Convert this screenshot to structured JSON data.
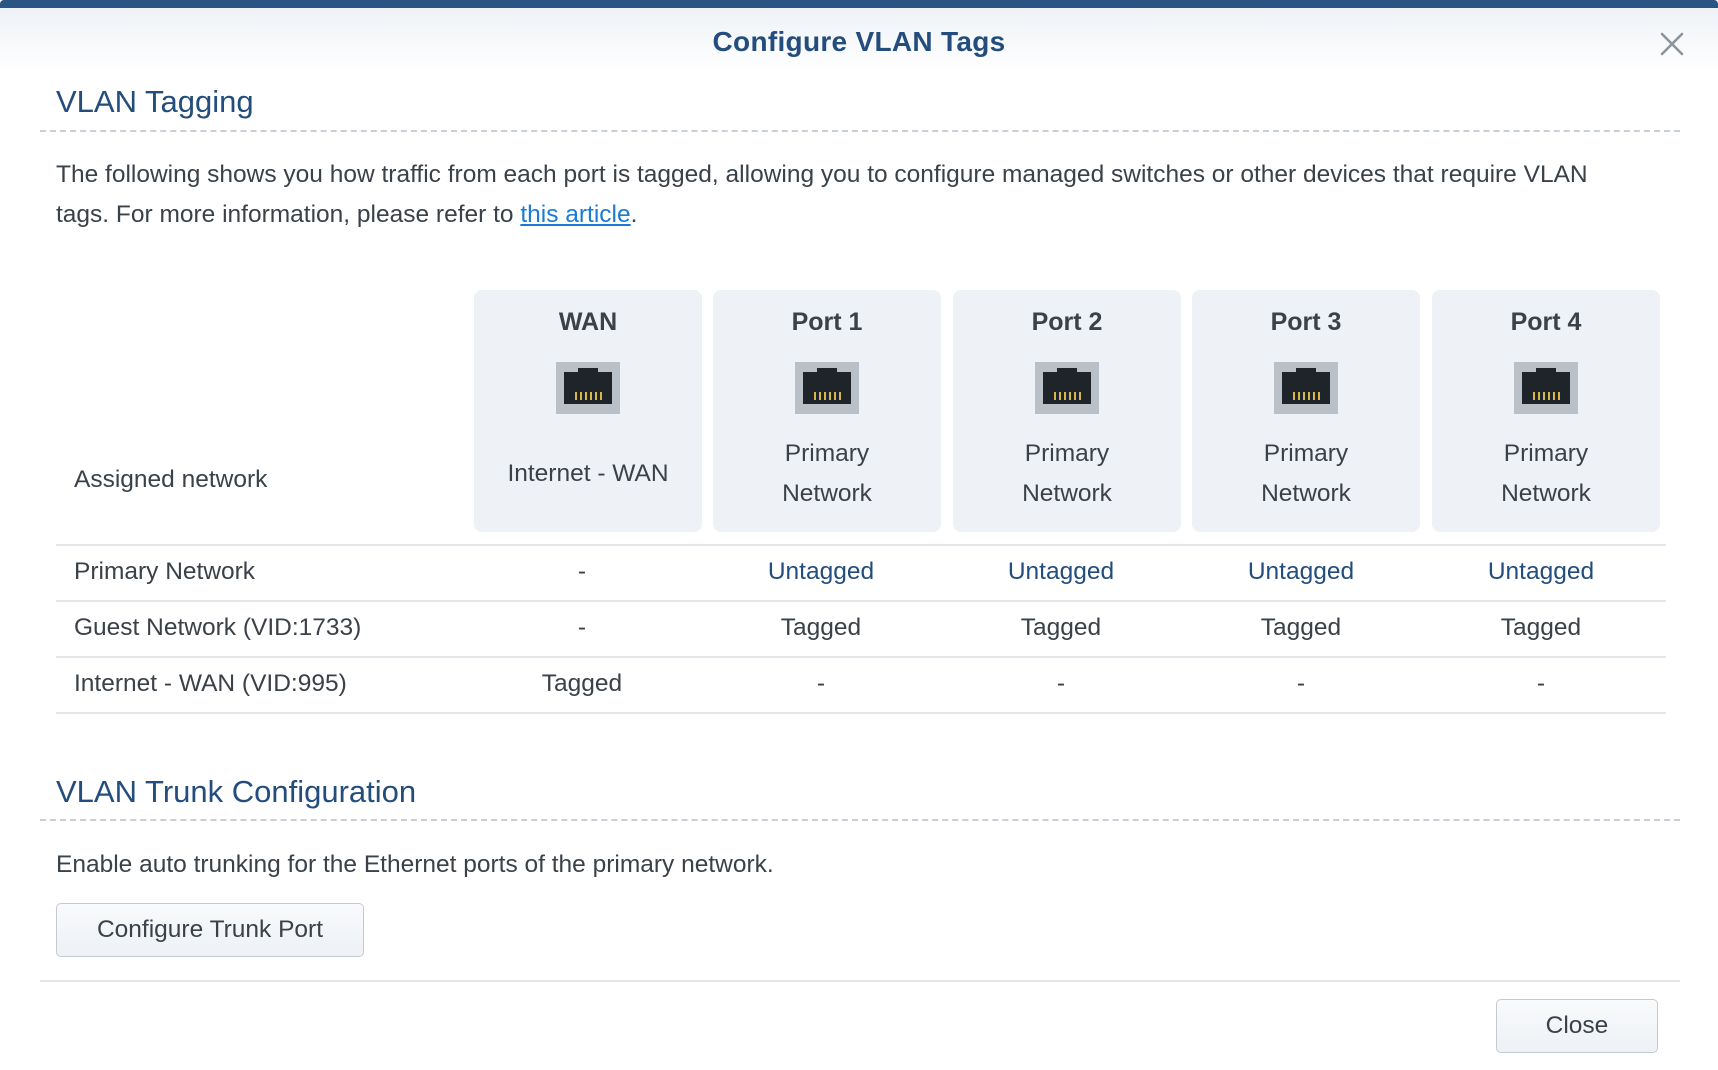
{
  "dialog": {
    "title": "Configure VLAN Tags",
    "close_icon": "close-x-icon"
  },
  "vlan_tagging": {
    "heading": "VLAN Tagging",
    "description": "The following shows you how traffic from each port is tagged, allowing you to configure managed switches or other devices that require VLAN tags. For more information, please refer to ",
    "link_text": "this article",
    "description_end": ".",
    "row_header_label": "Assigned network",
    "ports": [
      {
        "name": "WAN",
        "assigned_line1": "Internet - WAN",
        "assigned_line2": "",
        "icon": "ethernet-port-icon"
      },
      {
        "name": "Port 1",
        "assigned_line1": "Primary",
        "assigned_line2": "Network",
        "icon": "ethernet-port-icon"
      },
      {
        "name": "Port 2",
        "assigned_line1": "Primary",
        "assigned_line2": "Network",
        "icon": "ethernet-port-icon"
      },
      {
        "name": "Port 3",
        "assigned_line1": "Primary",
        "assigned_line2": "Network",
        "icon": "ethernet-port-icon"
      },
      {
        "name": "Port 4",
        "assigned_line1": "Primary",
        "assigned_line2": "Network",
        "icon": "ethernet-port-icon"
      }
    ],
    "rows": [
      {
        "label": "Primary Network",
        "cells": [
          "-",
          "Untagged",
          "Untagged",
          "Untagged",
          "Untagged"
        ]
      },
      {
        "label": "Guest Network (VID:1733)",
        "cells": [
          "-",
          "Tagged",
          "Tagged",
          "Tagged",
          "Tagged"
        ]
      },
      {
        "label": "Internet - WAN (VID:995)",
        "cells": [
          "Tagged",
          "-",
          "-",
          "-",
          "-"
        ]
      }
    ]
  },
  "trunk": {
    "heading": "VLAN Trunk Configuration",
    "description": "Enable auto trunking for the Ethernet ports of the primary network.",
    "button_label": "Configure Trunk Port"
  },
  "footer": {
    "close_label": "Close"
  },
  "colors": {
    "accent": "#234d7c",
    "link": "#1a7bd4",
    "card_bg": "#eef1f5"
  }
}
